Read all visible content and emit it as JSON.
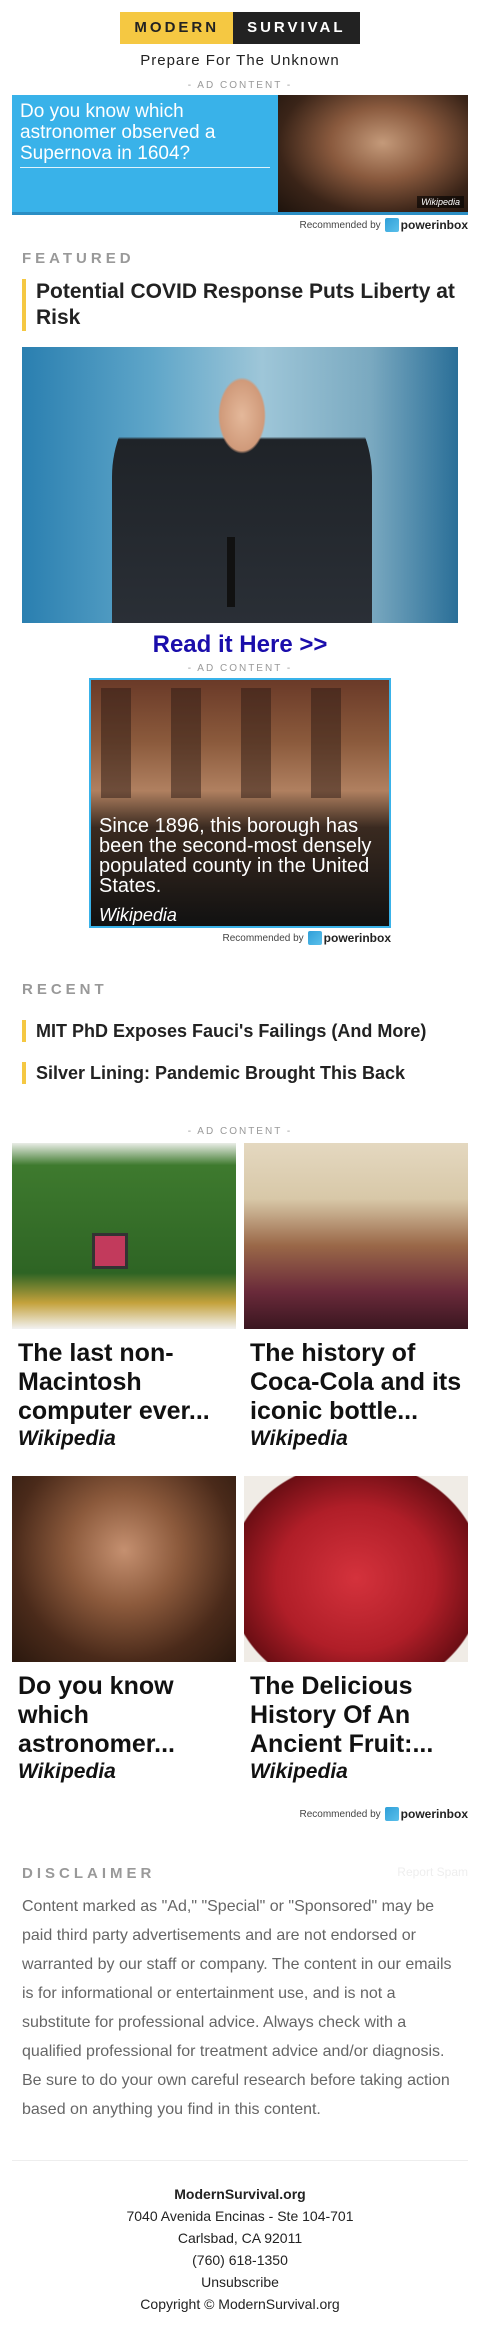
{
  "header": {
    "logo_left": "MODERN",
    "logo_right": "SURVIVAL",
    "tagline": "Prepare For The Unknown"
  },
  "ad_label": "- AD CONTENT -",
  "recommended_by": "Recommended by",
  "powerinbox": "powerinbox",
  "ad1": {
    "text": "Do you know which astronomer observed a Supernova in 1604?",
    "source": "Wikipedia"
  },
  "featured": {
    "section_title": "FEATURED",
    "headline": "Potential COVID Response Puts Liberty at Risk",
    "read_link": "Read it Here >>"
  },
  "ad2": {
    "text": "Since 1896, this borough has been the second-most densely populated county in the United States.",
    "source": "Wikipedia"
  },
  "recent": {
    "section_title": "RECENT",
    "items": [
      "MIT PhD Exposes Fauci's Failings (And More)",
      "Silver Lining: Pandemic Brought This Back"
    ]
  },
  "ad3": {
    "cards": [
      {
        "title": "The last non-Macintosh computer ever...",
        "source": "Wikipedia"
      },
      {
        "title": "The history of Coca-Cola and its iconic bottle...",
        "source": "Wikipedia"
      },
      {
        "title": "Do you know which astronomer...",
        "source": "Wikipedia"
      },
      {
        "title": "The Delicious History Of An Ancient Fruit:...",
        "source": "Wikipedia"
      }
    ]
  },
  "disclaimer": {
    "title": "DISCLAIMER",
    "report_spam": "Report Spam",
    "body": "Content marked as \"Ad,\" \"Special\" or \"Sponsored\" may be paid third party advertisements and are not endorsed or warranted by our staff or company. The content in our emails is for informational or entertainment use, and is not a substitute for professional advice. Always check with a qualified professional for treatment advice and/or diagnosis. Be sure to do your own careful research before taking action based on anything you find in this content."
  },
  "footer": {
    "org": "ModernSurvival.org",
    "address": "7040 Avenida Encinas - Ste 104-701",
    "city": "Carlsbad, CA 92011",
    "phone": "(760) 618-1350",
    "unsubscribe": "Unsubscribe",
    "copyright": "Copyright © ModernSurvival.org"
  }
}
